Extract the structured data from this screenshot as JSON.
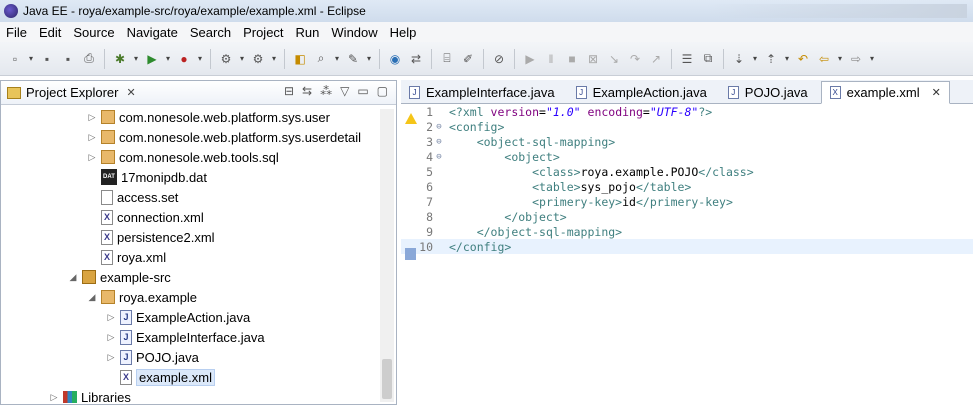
{
  "window": {
    "title": "Java EE - roya/example-src/roya/example/example.xml - Eclipse"
  },
  "menu": [
    "File",
    "Edit",
    "Source",
    "Navigate",
    "Search",
    "Project",
    "Run",
    "Window",
    "Help"
  ],
  "project_explorer": {
    "title": "Project Explorer",
    "tree": [
      {
        "label": "com.nonesole.web.platform.sys.user",
        "icon": "package-icon",
        "arrow": "▷",
        "indent": 1
      },
      {
        "label": "com.nonesole.web.platform.sys.userdetail",
        "icon": "package-icon",
        "arrow": "▷",
        "indent": 1
      },
      {
        "label": "com.nonesole.web.tools.sql",
        "icon": "package-icon",
        "arrow": "▷",
        "indent": 1
      },
      {
        "label": "17monipdb.dat",
        "icon": "dat-file-icon",
        "arrow": "",
        "indent": 1
      },
      {
        "label": "access.set",
        "icon": "text-file-icon",
        "arrow": "",
        "indent": 1
      },
      {
        "label": "connection.xml",
        "icon": "xml-file-icon",
        "arrow": "",
        "indent": 1
      },
      {
        "label": "persistence2.xml",
        "icon": "xml-file-icon",
        "arrow": "",
        "indent": 1
      },
      {
        "label": "roya.xml",
        "icon": "xml-file-icon",
        "arrow": "",
        "indent": 1
      },
      {
        "label": "example-src",
        "icon": "source-folder-icon",
        "arrow": "◢",
        "indent": 0
      },
      {
        "label": "roya.example",
        "icon": "package-icon",
        "arrow": "◢",
        "indent": 1
      },
      {
        "label": "ExampleAction.java",
        "icon": "java-file-icon",
        "arrow": "▷",
        "indent": 2
      },
      {
        "label": "ExampleInterface.java",
        "icon": "java-file-icon",
        "arrow": "▷",
        "indent": 2
      },
      {
        "label": "POJO.java",
        "icon": "java-file-icon",
        "arrow": "▷",
        "indent": 2
      },
      {
        "label": "example.xml",
        "icon": "xml-file-icon",
        "arrow": "",
        "indent": 2,
        "selected": true
      },
      {
        "label": "Libraries",
        "icon": "libraries-icon",
        "arrow": "▷",
        "indent": -1
      }
    ]
  },
  "editor": {
    "tabs": [
      {
        "label": "ExampleInterface.java",
        "icon": "java-file-icon",
        "active": false
      },
      {
        "label": "ExampleAction.java",
        "icon": "java-file-icon",
        "active": false
      },
      {
        "label": "POJO.java",
        "icon": "java-file-icon",
        "active": false
      },
      {
        "label": "example.xml",
        "icon": "xml-file-icon",
        "active": true
      }
    ],
    "lines": [
      {
        "n": "1",
        "fold": "",
        "marker": "warning",
        "parts": [
          [
            "t-decl",
            "<?xml "
          ],
          [
            "t-attr",
            "version"
          ],
          [
            "t-text",
            "="
          ],
          [
            "t-val",
            "\"1.0\""
          ],
          [
            "t-text",
            " "
          ],
          [
            "t-attr",
            "encoding"
          ],
          [
            "t-text",
            "="
          ],
          [
            "t-val",
            "\"UTF-8\""
          ],
          [
            "t-decl",
            "?>"
          ]
        ]
      },
      {
        "n": "2",
        "fold": "⊖",
        "marker": "",
        "parts": [
          [
            "t-tag",
            "<config>"
          ]
        ]
      },
      {
        "n": "3",
        "fold": "⊖",
        "marker": "",
        "parts": [
          [
            "t-text",
            "    "
          ],
          [
            "t-tag",
            "<object-sql-mapping>"
          ]
        ]
      },
      {
        "n": "4",
        "fold": "⊖",
        "marker": "",
        "parts": [
          [
            "t-text",
            "        "
          ],
          [
            "t-tag",
            "<object>"
          ]
        ]
      },
      {
        "n": "5",
        "fold": "",
        "marker": "",
        "parts": [
          [
            "t-text",
            "            "
          ],
          [
            "t-tag",
            "<class>"
          ],
          [
            "t-text",
            "roya.example.POJO"
          ],
          [
            "t-tag",
            "</class>"
          ]
        ]
      },
      {
        "n": "6",
        "fold": "",
        "marker": "",
        "parts": [
          [
            "t-text",
            "            "
          ],
          [
            "t-tag",
            "<table>"
          ],
          [
            "t-text",
            "sys_pojo"
          ],
          [
            "t-tag",
            "</table>"
          ]
        ]
      },
      {
        "n": "7",
        "fold": "",
        "marker": "",
        "parts": [
          [
            "t-text",
            "            "
          ],
          [
            "t-tag",
            "<primery-key>"
          ],
          [
            "t-text",
            "id"
          ],
          [
            "t-tag",
            "</primery-key>"
          ]
        ]
      },
      {
        "n": "8",
        "fold": "",
        "marker": "",
        "parts": [
          [
            "t-text",
            "        "
          ],
          [
            "t-tag",
            "</object>"
          ]
        ]
      },
      {
        "n": "9",
        "fold": "",
        "marker": "",
        "parts": [
          [
            "t-text",
            "    "
          ],
          [
            "t-tag",
            "</object-sql-mapping>"
          ]
        ]
      },
      {
        "n": "10",
        "fold": "",
        "marker": "selection",
        "current": true,
        "parts": [
          [
            "t-tag",
            "</config>"
          ]
        ]
      }
    ]
  }
}
